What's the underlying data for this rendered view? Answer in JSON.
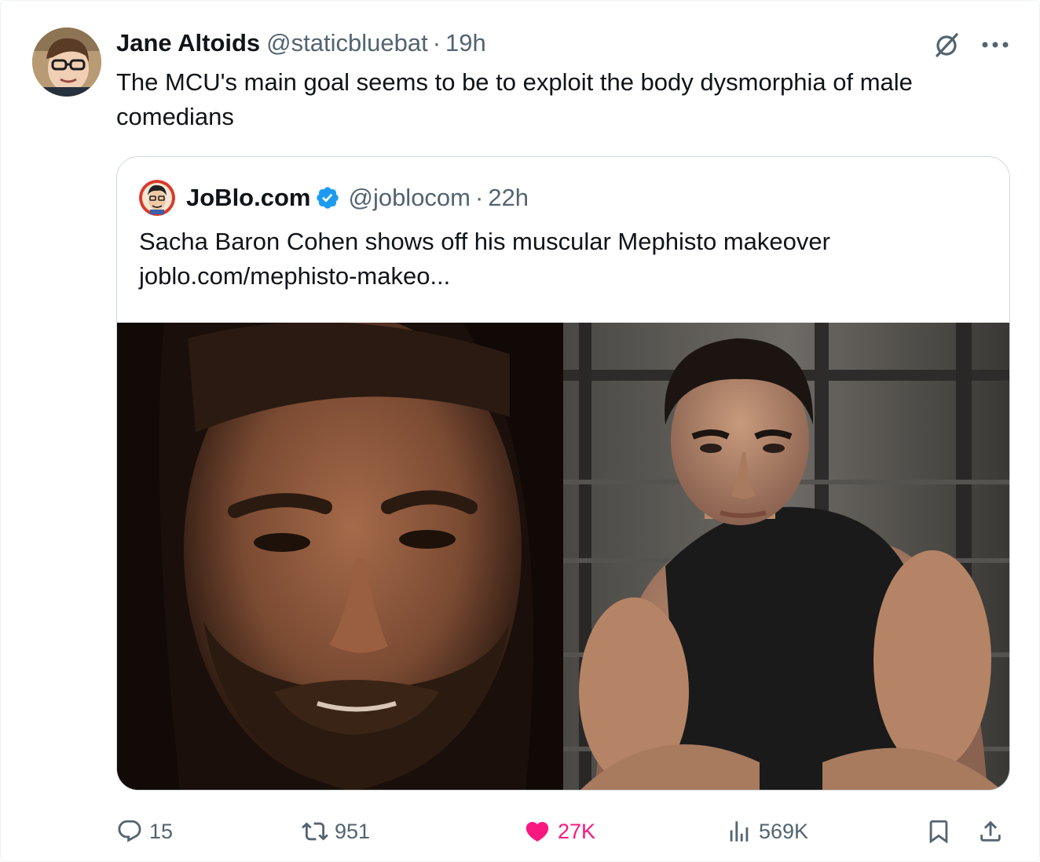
{
  "tweet": {
    "author": {
      "display_name": "Jane Altoids",
      "handle": "@staticbluebat",
      "separator": "·",
      "time": "19h"
    },
    "text": "The MCU's main goal seems to be to exploit the body dysmorphia of male comedians",
    "top_icons": [
      "grok-icon",
      "more-icon"
    ]
  },
  "quote": {
    "author": {
      "display_name": "JoBlo.com",
      "verified": true,
      "handle": "@joblocom",
      "separator": "·",
      "time": "22h"
    },
    "text": "Sacha Baron Cohen shows off his muscular Mephisto makeover",
    "link": "joblo.com/mephisto-makeo..."
  },
  "actions": {
    "replies": "15",
    "reposts": "951",
    "likes": "27K",
    "views": "569K"
  },
  "colors": {
    "text_primary": "#0f1419",
    "text_secondary": "#536471",
    "like_pink": "#f91880",
    "verified_blue": "#1d9bf0",
    "border": "#cfd9de"
  }
}
